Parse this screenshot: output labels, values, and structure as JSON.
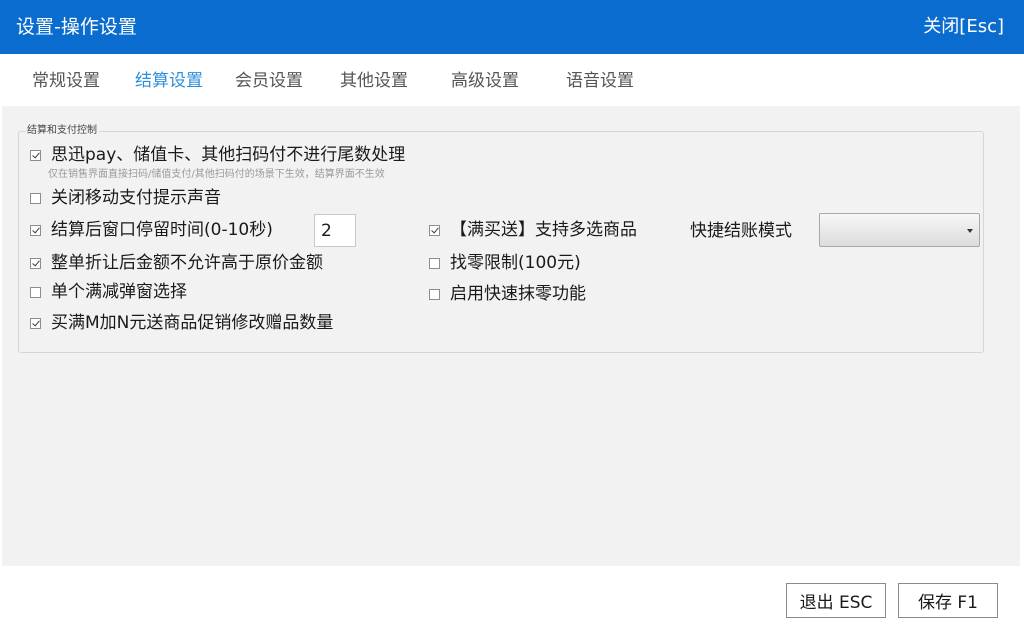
{
  "window": {
    "title": "设置-操作设置",
    "close_label": "关闭[Esc]"
  },
  "tabs": [
    {
      "label": "常规设置",
      "active": false
    },
    {
      "label": "结算设置",
      "active": true
    },
    {
      "label": "会员设置",
      "active": false
    },
    {
      "label": "其他设置",
      "active": false
    },
    {
      "label": "高级设置",
      "active": false
    },
    {
      "label": "语音设置",
      "active": false
    }
  ],
  "group": {
    "legend": "结算和支付控制",
    "options": [
      {
        "label": "思迅pay、储值卡、其他扫码付不进行尾数处理",
        "checked": true
      },
      {
        "label": "关闭移动支付提示声音",
        "checked": false
      },
      {
        "label": "结算后窗口停留时间(0-10秒)",
        "checked": true
      },
      {
        "label": "整单折让后金额不允许高于原价金额",
        "checked": true
      },
      {
        "label": "单个满减弹窗选择",
        "checked": false
      },
      {
        "label": "买满M加N元送商品促销修改赠品数量",
        "checked": true
      },
      {
        "label": "【满买送】支持多选商品",
        "checked": true
      },
      {
        "label": "找零限制(100元)",
        "checked": false
      },
      {
        "label": "启用快速抹零功能",
        "checked": false
      }
    ],
    "hint": "仅在销售界面直接扫码/储值支付/其他扫码付的场景下生效，结算界面不生效",
    "stay_time_value": "2",
    "quick_checkout_label": "快捷结账模式",
    "quick_checkout_value": ""
  },
  "footer": {
    "exit_label": "退出 ESC",
    "save_label": "保存 F1"
  }
}
